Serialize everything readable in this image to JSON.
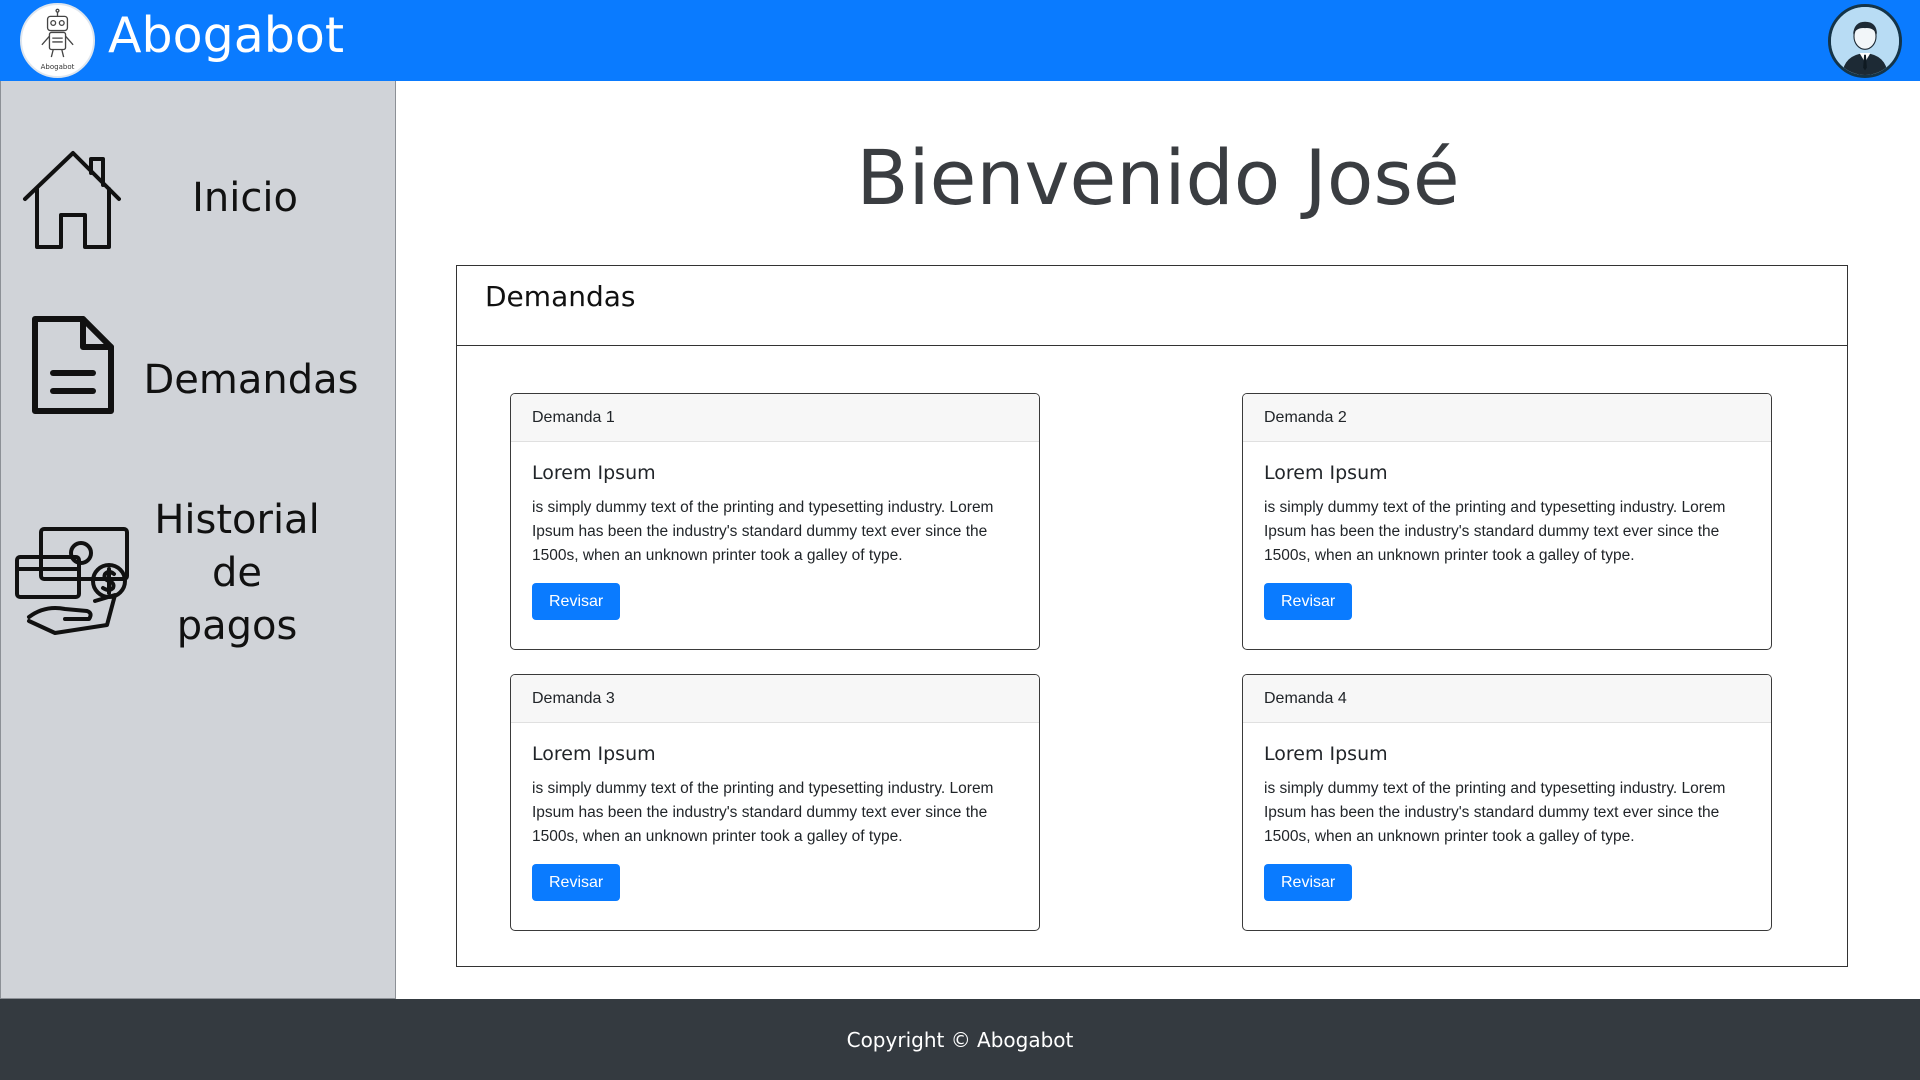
{
  "header": {
    "brand": "Abogabot",
    "logo_caption": "Abogabot",
    "logo_icon": "robot-icon",
    "avatar_icon": "user-avatar-icon"
  },
  "sidebar": {
    "items": [
      {
        "label": "Inicio",
        "icon": "home-icon"
      },
      {
        "label": "Demandas",
        "icon": "document-icon"
      },
      {
        "label_lines": [
          "Historial",
          "de",
          "pagos"
        ],
        "icon": "payment-icon"
      }
    ]
  },
  "main": {
    "welcome": "Bienvenido José",
    "panel": {
      "title": "Demandas",
      "cards": [
        {
          "header": "Demanda 1",
          "title": "Lorem Ipsum",
          "text": "is simply dummy text of the printing and typesetting industry. Lorem Ipsum has been the industry's standard dummy text ever since the 1500s, when an unknown printer took a galley of type.",
          "button": "Revisar"
        },
        {
          "header": "Demanda 2",
          "title": "Lorem Ipsum",
          "text": "is simply dummy text of the printing and typesetting industry. Lorem Ipsum has been the industry's standard dummy text ever since the 1500s, when an unknown printer took a galley of type.",
          "button": "Revisar"
        },
        {
          "header": "Demanda 3",
          "title": "Lorem Ipsum",
          "text": "is simply dummy text of the printing and typesetting industry. Lorem Ipsum has been the industry's standard dummy text ever since the 1500s, when an unknown printer took a galley of type.",
          "button": "Revisar"
        },
        {
          "header": "Demanda 4",
          "title": "Lorem Ipsum",
          "text": "is simply dummy text of the printing and typesetting industry. Lorem Ipsum has been the industry's standard dummy text ever since the 1500s, when an unknown printer took a galley of type.",
          "button": "Revisar"
        }
      ]
    }
  },
  "footer": {
    "copyright": "Copyright © Abogabot"
  },
  "colors": {
    "primary": "#0a7bff",
    "sidebar_bg": "#d0d3d8",
    "footer_bg": "#343a40"
  }
}
